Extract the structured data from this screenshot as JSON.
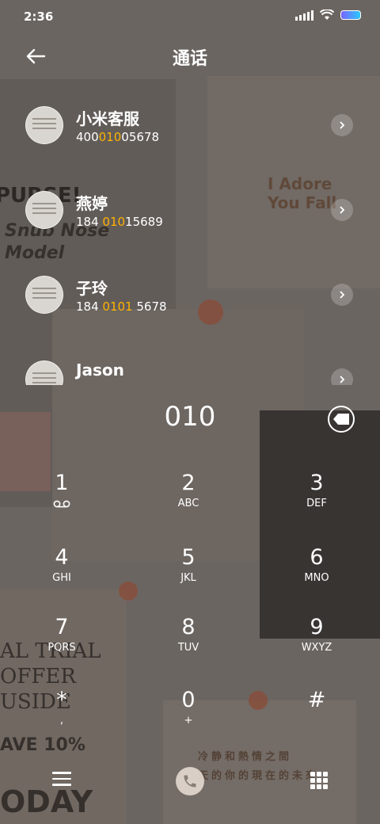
{
  "status_bar": {
    "time": "2:36"
  },
  "header": {
    "title": "通话"
  },
  "contacts": [
    {
      "name": "小米客服",
      "number_pre": "400",
      "number_match": "010",
      "number_post": "05678"
    },
    {
      "name": "燕婷",
      "number_pre": "184 ",
      "number_match": "010",
      "number_post": "15689"
    },
    {
      "name": "子玲",
      "number_pre": "184 ",
      "number_match": "0101",
      "number_post": " 5678"
    },
    {
      "name": "Jason",
      "number_pre": "",
      "number_match": "",
      "number_post": ""
    }
  ],
  "dialer": {
    "input": "010",
    "keys": [
      {
        "digit": "1",
        "letters": ""
      },
      {
        "digit": "2",
        "letters": "ABC"
      },
      {
        "digit": "3",
        "letters": "DEF"
      },
      {
        "digit": "4",
        "letters": "GHI"
      },
      {
        "digit": "5",
        "letters": "JKL"
      },
      {
        "digit": "6",
        "letters": "MNO"
      },
      {
        "digit": "7",
        "letters": "PQRS"
      },
      {
        "digit": "8",
        "letters": "TUV"
      },
      {
        "digit": "9",
        "letters": "WXYZ"
      },
      {
        "digit": "*",
        "letters": ","
      },
      {
        "digit": "0",
        "letters": "+"
      },
      {
        "digit": "#",
        "letters": ""
      }
    ]
  },
  "wallpaper": {
    "poster_1": "PURSE!",
    "poster_2": "Snub Nose\nModel",
    "poster_3": "I Adore\nYou Fall",
    "poster_4": "AL TRIAL\nOFFER\nUSIDE",
    "poster_5": "AVE 10%",
    "poster_6": "ODAY",
    "poster_7": "冷静和熱情之間\n天的你的現在的未來"
  },
  "colors": {
    "match_highlight": "#ffb300",
    "battery_gradient": [
      "#7a63ff",
      "#29c8ff"
    ]
  }
}
